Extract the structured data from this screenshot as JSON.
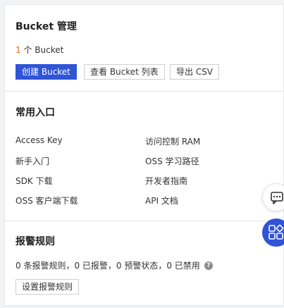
{
  "bucket": {
    "title": "Bucket 管理",
    "count_num": "1",
    "count_text": " 个 Bucket",
    "create_label": "创建 Bucket",
    "view_label": "查看 Bucket 列表",
    "export_label": "导出 CSV"
  },
  "entry": {
    "title": "常用入口",
    "links": [
      "Access Key",
      "访问控制 RAM",
      "新手入门",
      "OSS 学习路径",
      "SDK 下载",
      "开发者指南",
      "OSS 客户端下载",
      "API 文档"
    ]
  },
  "alarm": {
    "title": "报警规则",
    "stats": "0 条报警规则，0 已报警，0 预警状态，0 已禁用",
    "help_icon": "?",
    "setup_label": "设置报警规则"
  },
  "floating": {
    "chat_icon": "chat-icon",
    "apps_icon": "apps-icon"
  },
  "colors": {
    "accent": "#2f54d8",
    "count": "#ee6a1c"
  }
}
